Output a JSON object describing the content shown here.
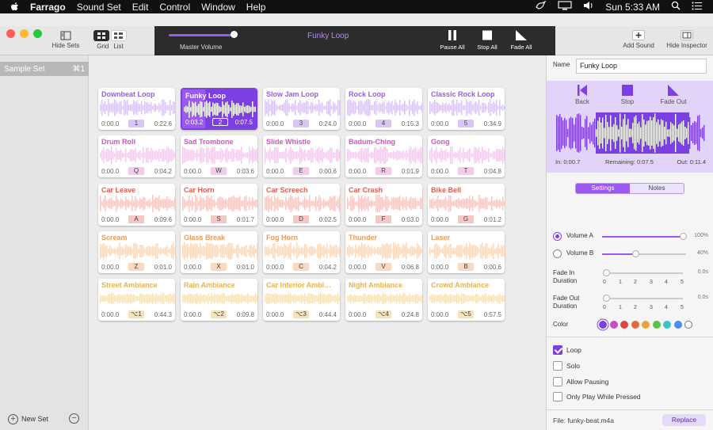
{
  "menubar": {
    "app_name": "Farrago",
    "items": [
      "Sound Set",
      "Edit",
      "Control",
      "Window",
      "Help"
    ],
    "clock": "Sun 5:33 AM"
  },
  "toolbar": {
    "hide_sets": "Hide Sets",
    "grid": "Grid",
    "list": "List",
    "master_volume": "Master Volume",
    "master_volume_level": 1.0,
    "now_playing": "Funky Loop",
    "pause_all": "Pause All",
    "stop_all": "Stop All",
    "fade_all": "Fade All",
    "add_sound": "Add Sound",
    "hide_inspector": "Hide Inspector"
  },
  "sidebar": {
    "sets": [
      {
        "label": "Sample Set",
        "shortcut": "⌘1"
      }
    ],
    "new_set": "New Set"
  },
  "colors": {
    "purple": "#9b59f0",
    "purple_light": "#d9c6f7",
    "magenta": "#d653c4",
    "magenta_light": "#f1cdec",
    "red": "#e45b4f",
    "red_light": "#f6c8c3",
    "orange": "#ee9a58",
    "orange_light": "#f9d9bf",
    "yellow": "#e8b24c",
    "yellow_light": "#f6e2bb"
  },
  "tiles": [
    [
      {
        "title": "Downbeat Loop",
        "start": "0:00.0",
        "key": "1",
        "end": "0:22.6",
        "color": "purple"
      },
      {
        "title": "Funky Loop",
        "start": "0:03.2",
        "key": "2",
        "end": "0:07.5",
        "color": "purple",
        "selected": true,
        "progress": 0.3
      },
      {
        "title": "Slow Jam Loop",
        "start": "0:00.0",
        "key": "3",
        "end": "0:24.0",
        "color": "purple"
      },
      {
        "title": "Rock Loop",
        "start": "0:00.0",
        "key": "4",
        "end": "0:15.3",
        "color": "purple"
      },
      {
        "title": "Classic Rock Loop",
        "start": "0:00.0",
        "key": "5",
        "end": "0:34.9",
        "color": "purple"
      }
    ],
    [
      {
        "title": "Drum Roll",
        "start": "0:00.0",
        "key": "Q",
        "end": "0:04.2",
        "color": "magenta"
      },
      {
        "title": "Sad Trombone",
        "start": "0:00.0",
        "key": "W",
        "end": "0:03.6",
        "color": "magenta"
      },
      {
        "title": "Slide Whistle",
        "start": "0:00.0",
        "key": "E",
        "end": "0:00.6",
        "color": "magenta"
      },
      {
        "title": "Badum-Ching",
        "start": "0:00.0",
        "key": "R",
        "end": "0:01.9",
        "color": "magenta"
      },
      {
        "title": "Gong",
        "start": "0:00.0",
        "key": "T",
        "end": "0:04.8",
        "color": "magenta"
      }
    ],
    [
      {
        "title": "Car Leave",
        "start": "0:00.0",
        "key": "A",
        "end": "0:09.6",
        "color": "red"
      },
      {
        "title": "Car Horn",
        "start": "0:00.0",
        "key": "S",
        "end": "0:01.7",
        "color": "red"
      },
      {
        "title": "Car Screech",
        "start": "0:00.0",
        "key": "D",
        "end": "0:02.5",
        "color": "red"
      },
      {
        "title": "Car Crash",
        "start": "0:00.0",
        "key": "F",
        "end": "0:03.0",
        "color": "red"
      },
      {
        "title": "Bike Bell",
        "start": "0:00.0",
        "key": "G",
        "end": "0:01.2",
        "color": "red"
      }
    ],
    [
      {
        "title": "Scream",
        "start": "0:00.0",
        "key": "Z",
        "end": "0:01.0",
        "color": "orange"
      },
      {
        "title": "Glass Break",
        "start": "0:00.0",
        "key": "X",
        "end": "0:01.0",
        "color": "orange"
      },
      {
        "title": "Fog Horn",
        "start": "0:00.0",
        "key": "C",
        "end": "0:04.2",
        "color": "orange"
      },
      {
        "title": "Thunder",
        "start": "0:00.0",
        "key": "V",
        "end": "0:06.8",
        "color": "orange"
      },
      {
        "title": "Laser",
        "start": "0:00.0",
        "key": "B",
        "end": "0:00.6",
        "color": "orange"
      }
    ],
    [
      {
        "title": "Street Ambiance",
        "start": "0:00.0",
        "key": "⌥1",
        "end": "0:44.3",
        "color": "yellow"
      },
      {
        "title": "Rain Ambiance",
        "start": "0:00.0",
        "key": "⌥2",
        "end": "0:09.8",
        "color": "yellow"
      },
      {
        "title": "Car Interior Ambi…",
        "start": "0:00.0",
        "key": "⌥3",
        "end": "0:44.4",
        "color": "yellow"
      },
      {
        "title": "Night Ambiance",
        "start": "0:00.0",
        "key": "⌥4",
        "end": "0:24.8",
        "color": "yellow"
      },
      {
        "title": "Crowd Ambiance",
        "start": "0:00.0",
        "key": "⌥5",
        "end": "0:57.5",
        "color": "yellow"
      }
    ]
  ],
  "inspector": {
    "name_label": "Name",
    "name_value": "Funky Loop",
    "back": "Back",
    "stop": "Stop",
    "fade_out": "Fade Out",
    "in_time": "In: 0:00.7",
    "remaining": "Remaining: 0:07.5",
    "out_time": "Out: 0:11.4",
    "tab_settings": "Settings",
    "tab_notes": "Notes",
    "volume_a": "Volume A",
    "volume_a_pct": "100%",
    "volume_a_level": 1.0,
    "volume_b": "Volume B",
    "volume_b_pct": "40%",
    "volume_b_level": 0.4,
    "fade_in": "Fade In Duration",
    "fade_in_value": "0.0s",
    "fade_out_dur": "Fade Out Duration",
    "fade_out_value": "0.0s",
    "ticks": [
      "0",
      "1",
      "2",
      "3",
      "4",
      "5"
    ],
    "color_label": "Color",
    "swatches": [
      "#7b3fe4",
      "#c94fc4",
      "#e04545",
      "#e66a3c",
      "#e8a33a",
      "#57c24a",
      "#3cc2c9",
      "#4a8fe8",
      "#ffffff"
    ],
    "loop": "Loop",
    "solo": "Solo",
    "allow_pausing": "Allow Pausing",
    "only_play_pressed": "Only Play While Pressed",
    "file": "File: funky-beat.m4a",
    "replace": "Replace"
  }
}
